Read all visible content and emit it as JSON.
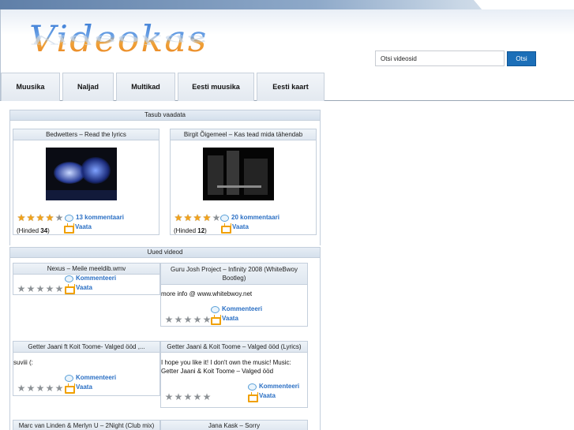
{
  "brand": {
    "logo_text": "Videokas"
  },
  "search": {
    "placeholder": "",
    "value": "Otsi videosid",
    "button_label": "Otsi"
  },
  "nav": {
    "items": [
      "Muusika",
      "Naljad",
      "Multikad",
      "Eesti muusika",
      "Eesti kaart"
    ]
  },
  "featured": {
    "title": "Tasub vaadata",
    "videos": [
      {
        "title": "Bedwetters – Read the lyrics",
        "comments": "13 kommentaari",
        "watch": "Vaata",
        "votes_prefix": "(Hinded ",
        "votes": "34",
        "votes_suffix": ")",
        "rating": 4
      },
      {
        "title": "Birgit Õigemeel – Kas tead mida tähendab",
        "comments": "20 kommentaari",
        "watch": "Vaata",
        "votes_prefix": "(Hinded ",
        "votes": "12",
        "votes_suffix": ")",
        "rating": 4
      }
    ]
  },
  "new_videos": {
    "title": "Uued videod",
    "videos": [
      {
        "title": "Nexus – Meile meeldib.wmv",
        "desc": "",
        "comment": "Kommenteeri",
        "watch": "Vaata",
        "rating": 0
      },
      {
        "title": "Guru Josh Project – Infinity 2008 (WhiteBwoy Bootleg)",
        "desc": "more info @ www.whitebwoy.net",
        "comment": "Kommenteeri",
        "watch": "Vaata",
        "rating": 0
      },
      {
        "title": "Getter Jaani ft Koit Toome- Valged ööd ,...",
        "desc": "suviii (:",
        "comment": "Kommenteeri",
        "watch": "Vaata",
        "rating": 0
      },
      {
        "title": "Getter Jaani & Koit Toome – Valged ööd (Lyrics)",
        "desc": "I hope you like it! I don't own the music! Music: Getter Jaani & Koit Toome – Valged ööd",
        "comment": "Kommenteeri",
        "watch": "Vaata",
        "rating": 0
      },
      {
        "title": "Marc van Linden & Merlyn U – 2Night (Club mix)",
        "desc": "",
        "comment": "",
        "watch": "",
        "rating": 0
      },
      {
        "title": "Jana Kask – Sorry",
        "desc": "",
        "comment": "",
        "watch": "",
        "rating": 0
      }
    ]
  },
  "colors": {
    "accent": "#1c6fb8",
    "link": "#2a6fc4",
    "star_on": "#f2a21a",
    "star_off": "#8d9296"
  }
}
